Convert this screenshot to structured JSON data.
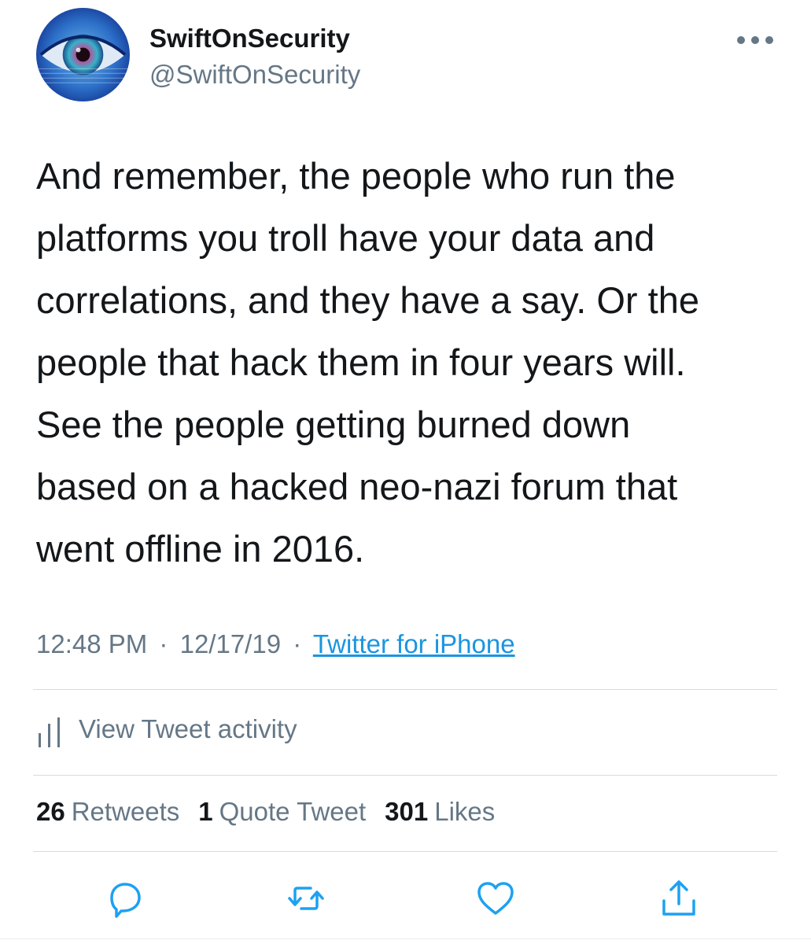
{
  "user": {
    "display_name": "SwiftOnSecurity",
    "handle": "@SwiftOnSecurity"
  },
  "tweet": {
    "lines": [
      "And remember, the people who run the",
      "platforms you troll have your data and",
      "correlations, and they have a say. Or the",
      "people that hack them in four years will.",
      "See the people getting burned down",
      "based on a hacked neo-nazi forum that",
      "went offline in 2016."
    ],
    "time": "12:48 PM",
    "date": "12/17/19",
    "source": "Twitter for iPhone",
    "separator": "·"
  },
  "activity": {
    "label": "View Tweet activity",
    "icon": "bar-chart-icon"
  },
  "stats": {
    "retweets_count": "26",
    "retweets_label": "Retweets",
    "quotes_count": "1",
    "quotes_label": "Quote Tweet",
    "likes_count": "301",
    "likes_label": "Likes"
  },
  "actions": {
    "icons": [
      "reply-icon",
      "retweet-icon",
      "like-icon",
      "share-icon"
    ]
  },
  "colors": {
    "text_primary": "#14171a",
    "text_secondary": "#657786",
    "link": "#1b95e0",
    "divider": "#d6dbdf",
    "icon": "#1da1f2"
  }
}
